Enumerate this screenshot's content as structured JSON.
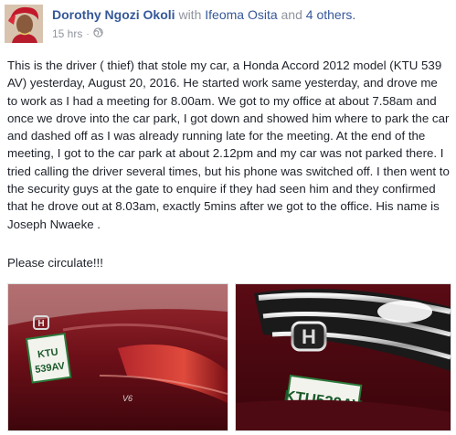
{
  "post": {
    "author": "Dorothy Ngozi Okoli",
    "with_prefix": "with",
    "tagged_name": "Ifeoma Osita",
    "tagged_joiner": "and",
    "others": "4 others.",
    "timestamp": "15 hrs",
    "separator": "·",
    "privacy_icon": "globe-icon",
    "body": "This is the driver ( thief) that stole my car, a Honda Accord 2012 model (KTU 539 AV) yesterday, August 20, 2016. He started work same yesterday, and drove me to work as I had a meeting for 8.00am. We got to my office at about 7.58am and once we drove into the car park, I got down and showed him where to park the car and dashed off as I was already running late for the meeting. At the end of the meeting, I got to the car park at about 2.12pm and my car was not parked there. I tried calling the driver several times, but his phone was switched off. I then went to the security guys at the gate to enquire if they had seen him and they confirmed that he drove out at 8.03am, exactly 5mins after we got to the office. His name is Joseph Nwaeke .",
    "closing": "Please circulate!!!"
  },
  "photos": {
    "left_plate": "KTU 539 AV",
    "right_plate": "KTU 539AV",
    "left_badge": "V6"
  },
  "colors": {
    "link": "#365899",
    "meta": "#90949c",
    "text": "#1d2129",
    "car_red": "#7a1420"
  }
}
